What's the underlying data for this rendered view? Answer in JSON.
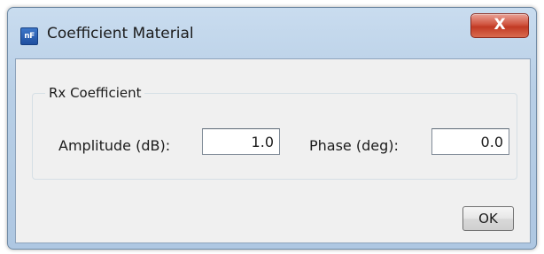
{
  "window": {
    "title": "Coefficient Material",
    "app_icon_text": "nF",
    "close_symbol": "X"
  },
  "group": {
    "label": "Rx Coefficient"
  },
  "fields": {
    "amplitude_label": "Amplitude (dB):",
    "amplitude_value": "1.0",
    "phase_label": "Phase (deg):",
    "phase_value": "0.0"
  },
  "buttons": {
    "ok_label": "OK"
  },
  "icons": {
    "app": "app-logo-icon",
    "close": "close-icon"
  },
  "colors": {
    "titlebar": "#b8cfe6",
    "close_button": "#c94a33",
    "client_background": "#f0f0f0"
  }
}
